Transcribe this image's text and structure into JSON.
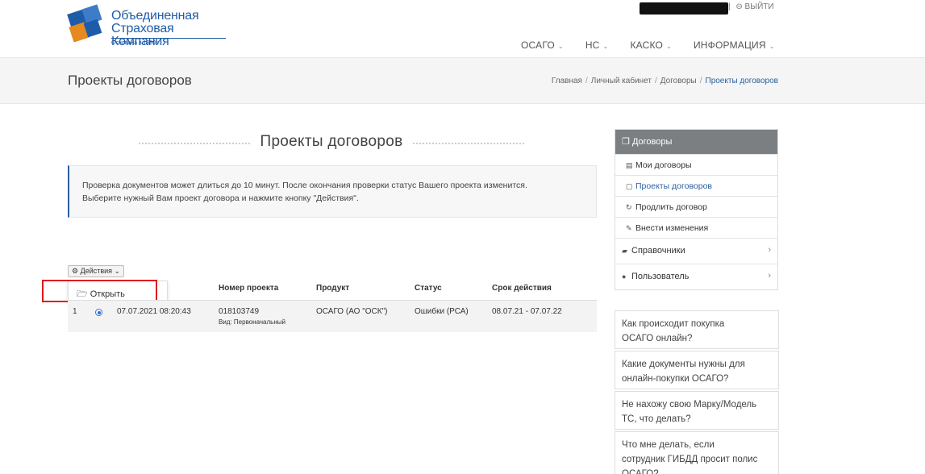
{
  "header": {
    "logo": {
      "line1": "Объединенная",
      "line2": "Страховая Компания",
      "sub": "Основана в 1990 г."
    },
    "top_links": {
      "separator": "|",
      "logout": "⊖ ВЫЙТИ"
    },
    "nav": [
      {
        "label": "ОСАГО"
      },
      {
        "label": "НС"
      },
      {
        "label": "КАСКО"
      },
      {
        "label": "ИНФОРМАЦИЯ"
      }
    ]
  },
  "titlebar": {
    "title": "Проекты договоров",
    "breadcrumb": [
      "Главная",
      "Личный кабинет",
      "Договоры",
      "Проекты договоров"
    ]
  },
  "main": {
    "section_title": "Проекты договоров",
    "info_line1": "Проверка документов может длиться до 10 минут. После окончания проверки статус Вашего проекта изменится.",
    "info_line2": "Выберите нужный Вам проект договора и нажмите кнопку \"Действия\".",
    "actions_label": "Действия",
    "dropdown_open": "Открыть",
    "table": {
      "headers": [
        "Номер проекта",
        "Продукт",
        "Статус",
        "Срок действия"
      ],
      "rows": [
        {
          "num": "1",
          "date": "07.07.2021 08:20:43",
          "project": "018103749",
          "kind": "Вид: Первоначальный",
          "product": "ОСАГО (АО \"ОСК\")",
          "status": "Ошибки (РСА)",
          "term": "08.07.21 - 07.07.22"
        }
      ]
    }
  },
  "sidebar": {
    "header": "Договоры",
    "items": [
      {
        "label": "Мои договоры"
      },
      {
        "label": "Проекты договоров"
      },
      {
        "label": "Продлить договор"
      },
      {
        "label": "Внести изменения"
      }
    ],
    "sections": [
      {
        "label": "Справочники"
      },
      {
        "label": "Пользователь"
      }
    ],
    "faq": [
      {
        "line1": "Как происходит покупка",
        "line2": "ОСАГО онлайн?"
      },
      {
        "line1": "Какие документы нужны для",
        "line2": "онлайн-покупки ОСАГО?"
      },
      {
        "line1": "Не нахожу свою Марку/Модель",
        "line2": "ТС, что делать?"
      },
      {
        "line1": "Что мне делать, если",
        "line2": "сотрудник ГИБДД просит полис",
        "line3": "ОСАГО?"
      }
    ]
  },
  "colors": {
    "brand_blue": "#1f5ca8",
    "accent_orange": "#e58a1f",
    "highlight_red": "#e01515",
    "sidebar_header": "#7c7f82"
  }
}
